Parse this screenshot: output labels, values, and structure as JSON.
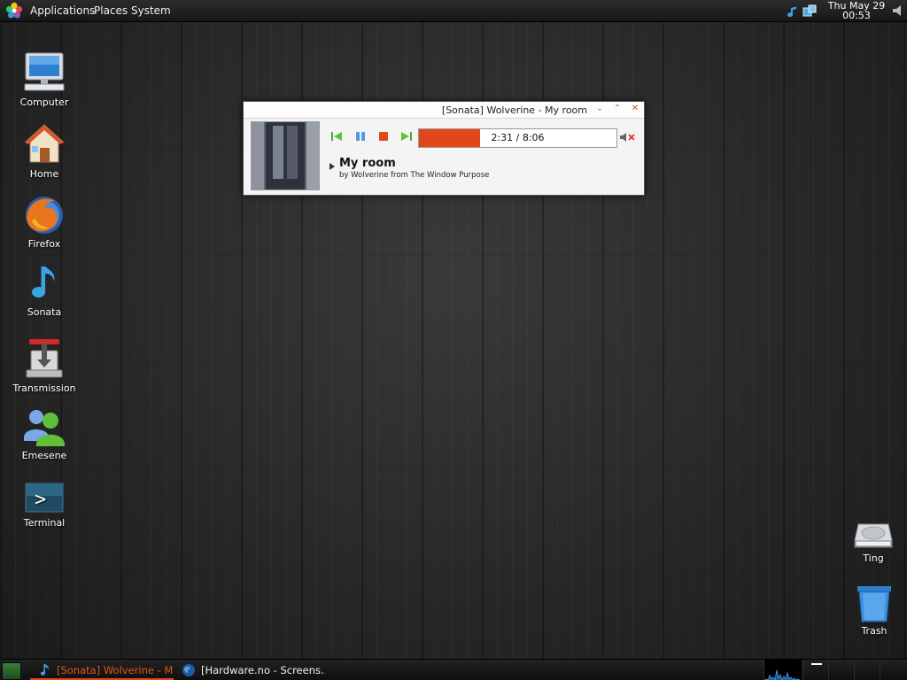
{
  "top_panel": {
    "menus": [
      "Applications",
      "Places",
      "System"
    ],
    "clock": {
      "date": "Thu May 29",
      "time": "00:53"
    },
    "tray_icons": [
      "sonata-note-icon",
      "network-icon",
      "volume-icon"
    ]
  },
  "desktop": {
    "icons": [
      {
        "label": "Computer",
        "icon": "computer-icon"
      },
      {
        "label": "Home",
        "icon": "home-icon"
      },
      {
        "label": "Firefox",
        "icon": "firefox-icon"
      },
      {
        "label": "Sonata",
        "icon": "music-note-icon"
      },
      {
        "label": "Transmission",
        "icon": "transmission-icon"
      },
      {
        "label": "Emesene",
        "icon": "emesene-icon"
      },
      {
        "label": "Terminal",
        "icon": "terminal-icon"
      },
      {
        "label": "Ting",
        "icon": "drive-icon"
      },
      {
        "label": "Trash",
        "icon": "trash-icon"
      }
    ]
  },
  "sonata": {
    "title": "[Sonata] Wolverine - My room",
    "progress": {
      "text": "2:31 / 8:06",
      "fraction": 0.311
    },
    "song_title": "My room",
    "song_subtitle": "by Wolverine from The Window Purpose",
    "colors": {
      "accent": "#e1471a"
    }
  },
  "taskbar": {
    "tasks": [
      {
        "label": "[Sonata] Wolverine - M...",
        "active": true,
        "icon": "music-note-icon"
      },
      {
        "label": "[Hardware.no - Screens...",
        "active": false,
        "icon": "globe-icon"
      }
    ]
  }
}
